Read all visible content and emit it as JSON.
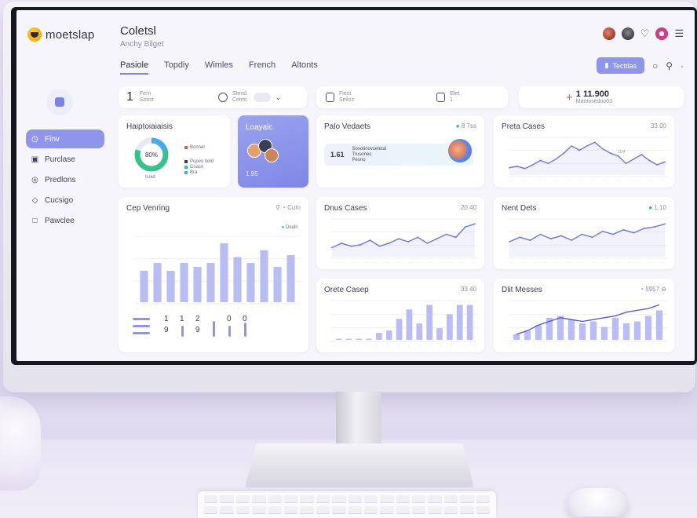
{
  "app": {
    "logo_text": "moetslap",
    "title": "Coletsl",
    "subtitle": "Anchy Bilget"
  },
  "tabs": [
    {
      "label": "Pasiole",
      "active": true
    },
    {
      "label": "Topdiy",
      "active": false
    },
    {
      "label": "Wimles",
      "active": false
    },
    {
      "label": "French",
      "active": false
    },
    {
      "label": "Altonts",
      "active": false
    }
  ],
  "toolbar": {
    "action_label": "Tecttlas",
    "icons": [
      "circle-icon",
      "search-icon",
      "more-icon"
    ]
  },
  "header_icons": [
    "avatar",
    "avatar",
    "heart-icon",
    "badge",
    "menu-icon"
  ],
  "sidebar": {
    "items": [
      {
        "label": "Finv",
        "icon": "clock-icon",
        "active": true
      },
      {
        "label": "Purclase",
        "icon": "box-icon",
        "active": false
      },
      {
        "label": "Predlons",
        "icon": "target-icon",
        "active": false
      },
      {
        "label": "Cucsigo",
        "icon": "pin-icon",
        "active": false
      },
      {
        "label": "Pawclee",
        "icon": "square-icon",
        "active": false
      }
    ]
  },
  "filters": {
    "f1": {
      "number": "1",
      "line1": "Fern",
      "line2": "Sonst"
    },
    "f2": {
      "line1": "Stend",
      "line2": "Cetmt"
    },
    "f3": {
      "line1": "Fiest",
      "line2": "Seiloz"
    },
    "f4": {
      "line1": "Efet",
      "line2": "1"
    },
    "stat": {
      "value": "1  11.900",
      "label": "Maotosedoo03"
    }
  },
  "cards": {
    "donut": {
      "title": "Haiptoiaiaisis",
      "center": "80%",
      "bottom": "Isuid",
      "legend": [
        "Bonnel",
        "Pupeo tiold",
        "Coaso",
        "Bra"
      ]
    },
    "loyal": {
      "title": "Loayalc",
      "value": "1.95"
    },
    "promo": {
      "title": "Palo Vedaets",
      "meta": "8 7ss",
      "number": "1.61",
      "line1": "Sosotinovseletal",
      "line2": "Trusones",
      "line3": "Pesno"
    },
    "bars": {
      "title": "Cep Venring",
      "meta": "Cutn",
      "legend": "Dealli",
      "stats": [
        "1",
        "1",
        "2",
        "0",
        "0",
        "9",
        "9"
      ]
    },
    "line1": {
      "title": "Preta Cases",
      "meta": "33.00",
      "ann": "11M"
    },
    "line2": {
      "title": "Dnus Cases",
      "meta": "20.40"
    },
    "line3": {
      "title": "Nent Dets",
      "meta": "1.10"
    },
    "bars2": {
      "title": "Orete Casep",
      "meta": "33.40"
    },
    "combo": {
      "title": "Dlit Messes",
      "meta": "5957"
    }
  },
  "chart_data": [
    {
      "type": "bar",
      "title": "Cep Venring",
      "values": [
        32,
        40,
        32,
        40,
        36,
        40,
        60,
        46,
        40,
        53,
        36,
        48
      ]
    },
    {
      "type": "line",
      "title": "Preta Cases",
      "values": [
        10,
        12,
        9,
        14,
        20,
        16,
        22,
        30,
        40,
        34,
        40,
        45,
        36,
        30,
        26,
        16,
        22,
        28,
        20,
        14,
        18
      ]
    },
    {
      "type": "line",
      "title": "Dnus Cases",
      "values": [
        12,
        18,
        14,
        16,
        22,
        14,
        18,
        24,
        20,
        26,
        18,
        24,
        30,
        26,
        40,
        44
      ]
    },
    {
      "type": "line",
      "title": "Nent Dets",
      "values": [
        20,
        26,
        22,
        30,
        24,
        28,
        22,
        30,
        26,
        34,
        30,
        36,
        32,
        38,
        40,
        44
      ]
    },
    {
      "type": "bar",
      "title": "Orete Casep",
      "values": [
        1,
        1,
        1,
        1,
        6,
        8,
        18,
        26,
        14,
        30,
        10,
        22,
        30,
        30
      ]
    },
    {
      "type": "bar",
      "title": "Dlit Messes",
      "values": [
        6,
        10,
        16,
        24,
        26,
        22,
        18,
        20,
        14,
        24,
        18,
        20,
        26,
        32
      ],
      "line": [
        6,
        10,
        16,
        20,
        24,
        22,
        20,
        22,
        24,
        26,
        30,
        32,
        34,
        38
      ]
    }
  ],
  "colors": {
    "accent": "#8f96ea",
    "bar": "#b9bdf2",
    "line": "#6f76dd",
    "green": "#2fb58b",
    "donut_green": "#37c28d",
    "donut_blue": "#49a9e9"
  }
}
